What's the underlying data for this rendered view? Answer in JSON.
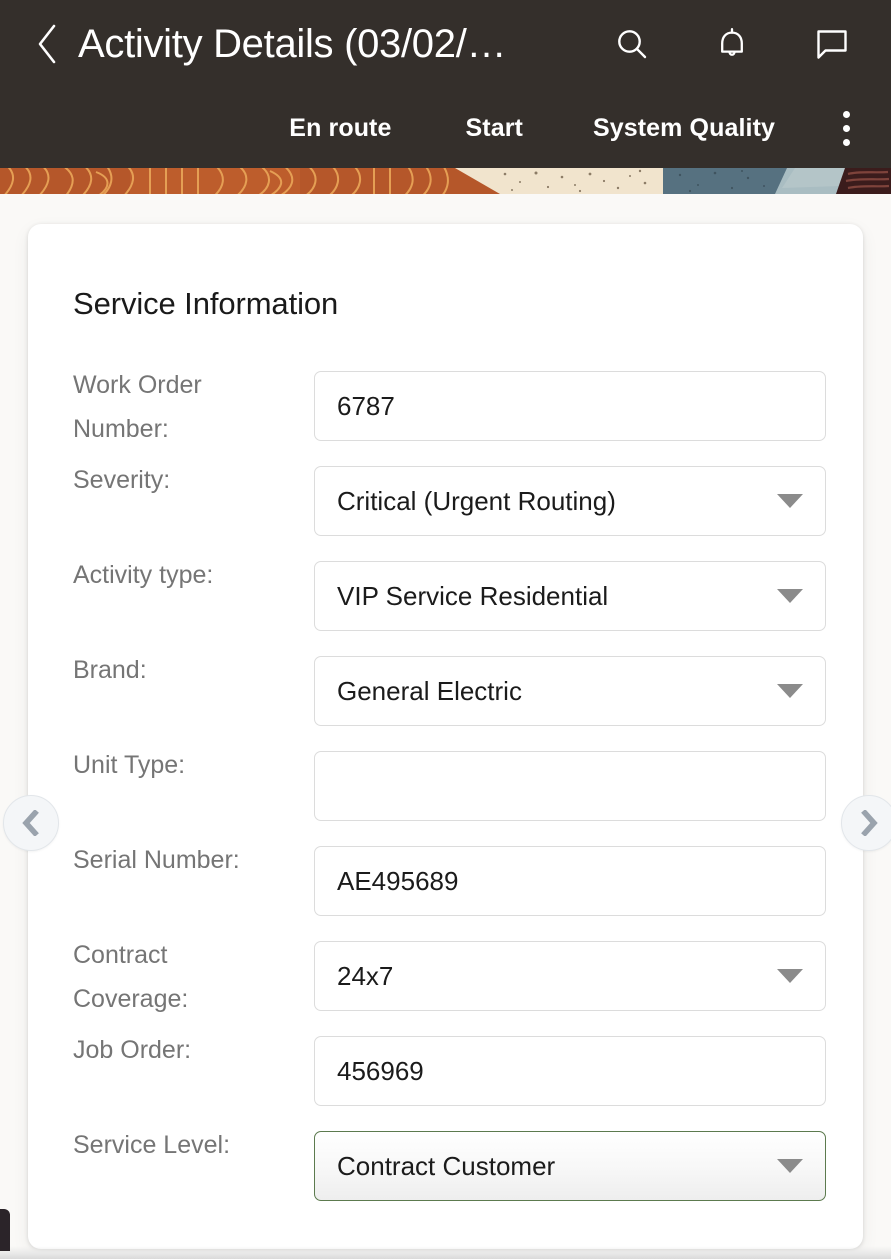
{
  "appbar": {
    "back_icon": "chevron-left-icon",
    "title": "Activity Details (03/02/…",
    "icons": [
      {
        "name": "search-icon",
        "label": "Search"
      },
      {
        "name": "bell-icon",
        "label": "Notifications"
      },
      {
        "name": "chat-icon",
        "label": "Messages"
      }
    ],
    "actions": [
      {
        "label": "En route"
      },
      {
        "label": "Start"
      },
      {
        "label": "System Quality"
      }
    ],
    "overflow_icon": "more-vertical-icon",
    "background_color": "#342f2b",
    "text_color": "#ffffff"
  },
  "banner": {
    "name": "decorative-banner-strip",
    "colors": [
      "#b35a2d",
      "#c4602e",
      "#f1e4cd",
      "#5a7480",
      "#a9bdc2",
      "#3b1c1c"
    ]
  },
  "nav": {
    "prev_icon": "chevron-left-icon",
    "next_icon": "chevron-right-icon"
  },
  "card": {
    "title": "Service Information",
    "fields": [
      {
        "label": "Work Order Number:",
        "value": "6787",
        "type": "text",
        "name": "work-order-number",
        "selected": false
      },
      {
        "label": "Severity:",
        "value": "Critical (Urgent Routing)",
        "type": "select",
        "name": "severity",
        "selected": false
      },
      {
        "label": "Activity type:",
        "value": "VIP Service Residential",
        "type": "select",
        "name": "activity-type",
        "selected": false
      },
      {
        "label": "Brand:",
        "value": "General Electric",
        "type": "select",
        "name": "brand",
        "selected": false
      },
      {
        "label": "Unit Type:",
        "value": "",
        "type": "text",
        "name": "unit-type",
        "selected": false
      },
      {
        "label": "Serial Number:",
        "value": "AE495689",
        "type": "text",
        "name": "serial-number",
        "selected": false
      },
      {
        "label": "Contract Coverage:",
        "value": "24x7",
        "type": "select",
        "name": "contract-coverage",
        "selected": false
      },
      {
        "label": "Job Order:",
        "value": "456969",
        "type": "text",
        "name": "job-order",
        "selected": false
      },
      {
        "label": "Service Level:",
        "value": "Contract Customer",
        "type": "select",
        "name": "service-level",
        "selected": true
      }
    ]
  },
  "colors": {
    "appbar_bg": "#342f2b",
    "page_bg": "#faf9f7",
    "card_bg": "#ffffff",
    "label_text": "#757575",
    "value_text": "#1b1b1b",
    "field_border": "#dcdcdc",
    "selected_border": "#5c7a4e",
    "caret": "#8b8b8b"
  }
}
